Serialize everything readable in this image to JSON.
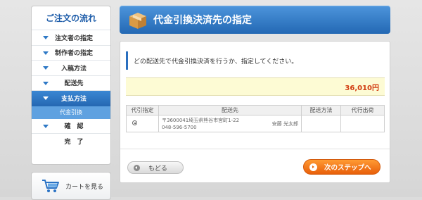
{
  "sidebar": {
    "title": "ご注文の流れ",
    "steps": [
      {
        "label": "注文者の指定"
      },
      {
        "label": "制作者の指定"
      },
      {
        "label": "入稿方法"
      },
      {
        "label": "配送先"
      },
      {
        "label": "支払方法"
      },
      {
        "label": "代金引換"
      },
      {
        "label": "確　認"
      },
      {
        "label": "完　了"
      }
    ],
    "cart_label": "カートを見る"
  },
  "header": {
    "title": "代金引換決済先の指定"
  },
  "main": {
    "instruction": "どの配送先で代金引換決済を行うか、指定してください。",
    "amount": "36,010円",
    "table": {
      "headers": [
        "代引指定",
        "配送先",
        "配送方法",
        "代行出荷"
      ],
      "rows": [
        {
          "address_line1": "〒3600041埼玉県熊谷市宮町1-22",
          "address_line2": "048-596-5700",
          "name": "安藤 光太郎",
          "method": "",
          "proxy": ""
        }
      ]
    },
    "back_label": "もどる",
    "next_label": "次のステップへ"
  },
  "colors": {
    "accent": "#2a72c4",
    "price": "#d13b10",
    "next_button": "#f07a1c"
  }
}
